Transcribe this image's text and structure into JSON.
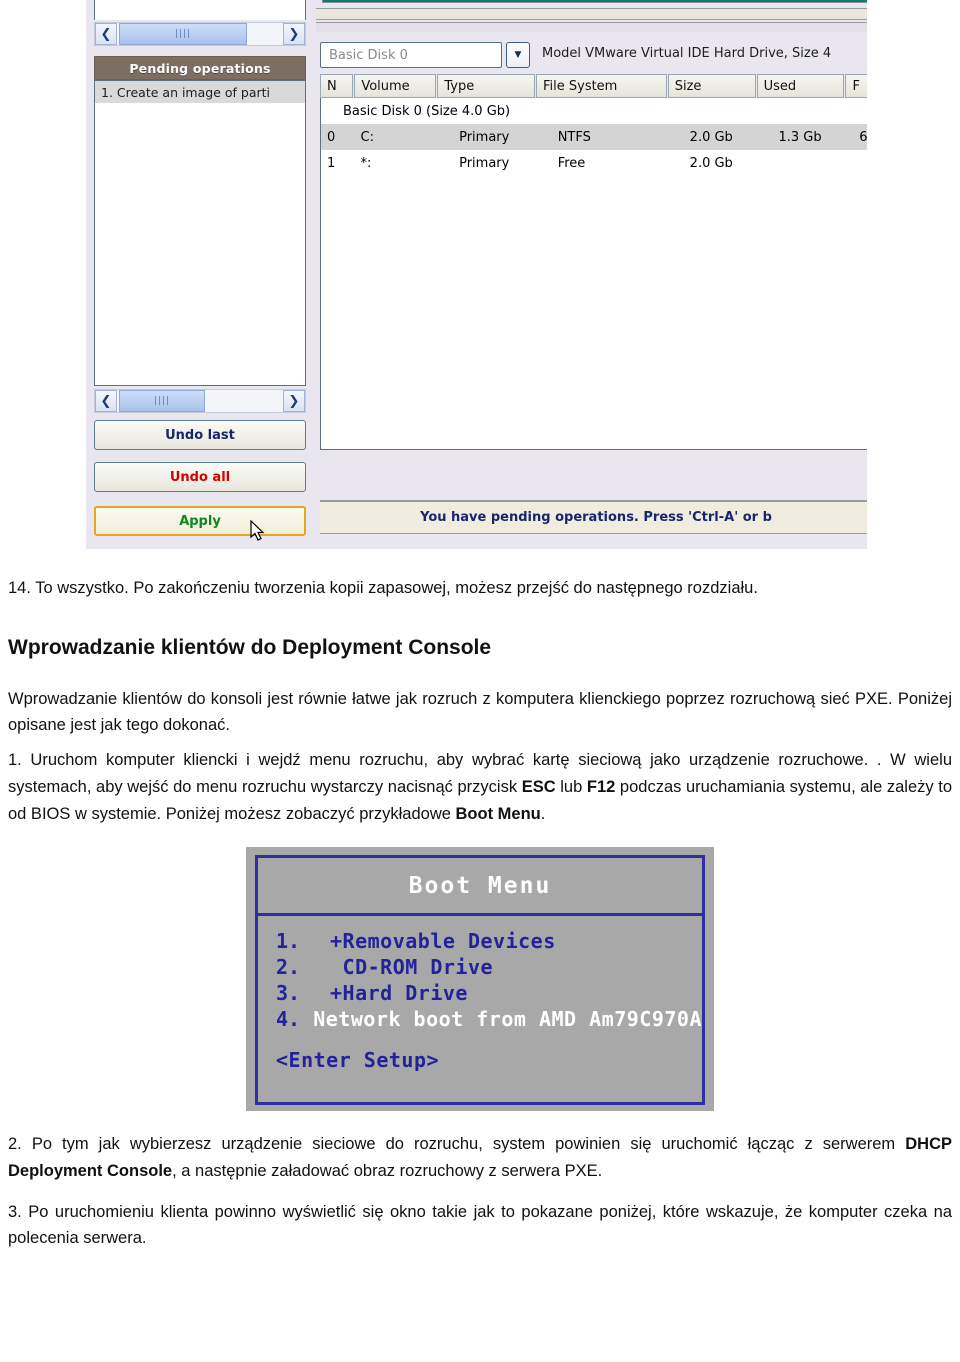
{
  "screenshot": {
    "left_panel": {
      "pending_header": "Pending operations",
      "pending_items": [
        "1. Create an image of parti"
      ],
      "buttons": [
        {
          "label": "Undo last",
          "color": "#19266e"
        },
        {
          "label": "Undo all",
          "color": "#d40000"
        },
        {
          "label": "Apply",
          "color": "#0a8a1e"
        }
      ]
    },
    "right_panel": {
      "disk_selector_value": "Basic Disk 0",
      "disk_model_label": "Model VMware Virtual IDE Hard Drive, Size 4",
      "table": {
        "columns": [
          "N",
          "Volume",
          "Type",
          "File System",
          "Size",
          "Used",
          "F"
        ],
        "group_row": "Basic Disk 0 (Size 4.0 Gb)",
        "rows": [
          {
            "n": "0",
            "volume": "C:",
            "type": "Primary",
            "fs": "NTFS",
            "size": "2.0 Gb",
            "used": "1.3 Gb",
            "free": "6",
            "selected": true
          },
          {
            "n": "1",
            "volume": "*:",
            "type": "Primary",
            "fs": "Free",
            "size": "2.0 Gb",
            "used": "",
            "free": "",
            "selected": false
          }
        ]
      },
      "status_text": "You have pending operations. Press 'Ctrl-A' or b"
    }
  },
  "document": {
    "step_14": "14. To wszystko. Po zakończeniu tworzenia kopii zapasowej, możesz przejść do następnego rozdziału.",
    "heading": "Wprowadzanie klientów do Deployment Console",
    "intro": "Wprowadzanie klientów do konsoli jest równie łatwe jak rozruch z komputera klienckiego poprzez rozruchową sieć PXE. Poniżej opisane jest jak tego dokonać.",
    "step_1_part1": "1. Uruchom komputer kliencki i wejdź menu rozruchu, aby wybrać kartę sieciową jako urządzenie rozruchowe. . W wielu systemach, aby wejść do menu rozruchu wystarczy nacisnąć przycisk ",
    "step_1_key_esc": "ESC",
    "step_1_part2": " lub ",
    "step_1_key_f12": "F12",
    "step_1_part3": " podczas uruchamiania systemu, ale zależy to od BIOS w systemie. Poniżej możesz zobaczyć przykładowe ",
    "step_1_bootmenu": "Boot Menu",
    "step_1_part4": ".",
    "step_2_part1": "2. Po tym jak wybierzesz urządzenie sieciowe do rozruchu, system powinien się uruchomić łącząc z serwerem ",
    "step_2_bold": "DHCP Deployment Console",
    "step_2_part2": ", a następnie załadować obraz rozruchowy z serwera PXE.",
    "step_3": "3. Po uruchomieniu klienta powinno wyświetlić się okno takie jak to pokazane poniżej, które wskazuje, że komputer czeka na polecenia serwera."
  },
  "boot_menu": {
    "title": "Boot Menu",
    "items": [
      {
        "num": "1.",
        "label": "+Removable Devices",
        "highlighted": false
      },
      {
        "num": "2.",
        "label": " CD-ROM Drive",
        "highlighted": false
      },
      {
        "num": "3.",
        "label": "+Hard Drive",
        "highlighted": false
      },
      {
        "num": "4.",
        "label": " Network boot from AMD Am79C970A",
        "highlighted": true
      }
    ],
    "setup_label": "<Enter Setup>"
  }
}
